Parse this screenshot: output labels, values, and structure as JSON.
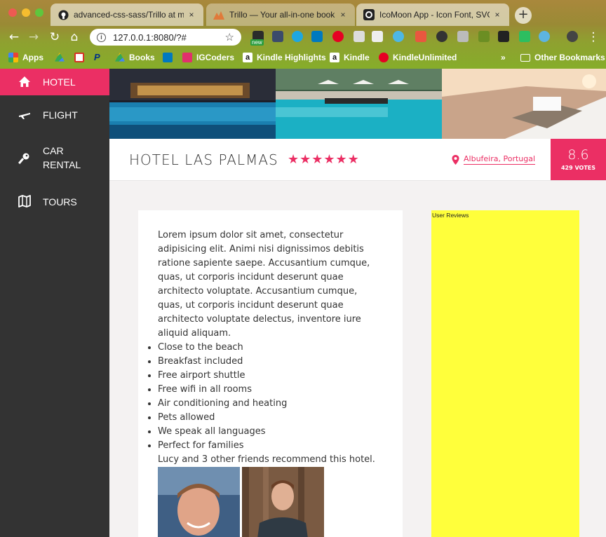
{
  "browser": {
    "tabs": [
      {
        "title": "advanced-css-sass/Trillo at ma",
        "close": "×"
      },
      {
        "title": "Trillo — Your all-in-one booking",
        "close": "×"
      },
      {
        "title": "IcoMoon App - Icon Font, SVG,",
        "close": "×"
      }
    ],
    "new_tab": "+",
    "url": "127.0.0.1:8080/?#",
    "ext_new_badge": "new",
    "bookmarks": [
      {
        "label": "Apps",
        "icon": "apps-grid-icon"
      },
      {
        "label": "",
        "icon": "google-drive-icon"
      },
      {
        "label": "",
        "icon": "gmail-icon"
      },
      {
        "label": "",
        "icon": "paypal-icon"
      },
      {
        "label": "Books",
        "icon": "google-drive-icon"
      },
      {
        "label": "",
        "icon": "trello-icon"
      },
      {
        "label": "IGCoders",
        "icon": "camera-icon"
      },
      {
        "label": "Kindle Highlights",
        "icon": "amazon-icon"
      },
      {
        "label": "Kindle",
        "icon": "amazon-icon"
      },
      {
        "label": "KindleUnlimited",
        "icon": "pinterest-icon"
      }
    ],
    "more_bookmarks": "»",
    "other_bookmarks": "Other Bookmarks"
  },
  "sidebar": {
    "items": [
      {
        "label": "Hotel",
        "icon": "home-icon",
        "active": true
      },
      {
        "label": "Flight",
        "icon": "airplane-icon",
        "active": false
      },
      {
        "label_line1": "Car",
        "label_line2": "Rental",
        "icon": "key-icon",
        "active": false
      },
      {
        "label": "Tours",
        "icon": "map-icon",
        "active": false
      }
    ]
  },
  "hotel": {
    "name": "Hotel Las Palmas",
    "stars": "★★★★★★",
    "location": "Albufeira, Portugal",
    "rating": "8.6",
    "votes": "429 votes"
  },
  "description": {
    "text": "Lorem ipsum dolor sit amet, consectetur adipisicing elit. Animi nisi dignissimos debitis ratione sapiente saepe. Accusantium cumque, quas, ut corporis incidunt deserunt quae architecto voluptate. Accusantium cumque, quas, ut corporis incidunt deserunt quae architecto voluptate delectus, inventore iure aliquid aliquam.",
    "features": [
      "Close to the beach",
      "Breakfast included",
      "Free airport shuttle",
      "Free wifi in all rooms",
      "Air conditioning and heating",
      "Pets allowed",
      "We speak all languages",
      "Perfect for families"
    ],
    "recommend": "Lucy and 3 other friends recommend this hotel."
  },
  "reviews": {
    "title": "User Reviews"
  },
  "colors": {
    "primary": "#eb2f64",
    "sidebar": "#333333",
    "reviews_bg": "#ffff3b"
  }
}
